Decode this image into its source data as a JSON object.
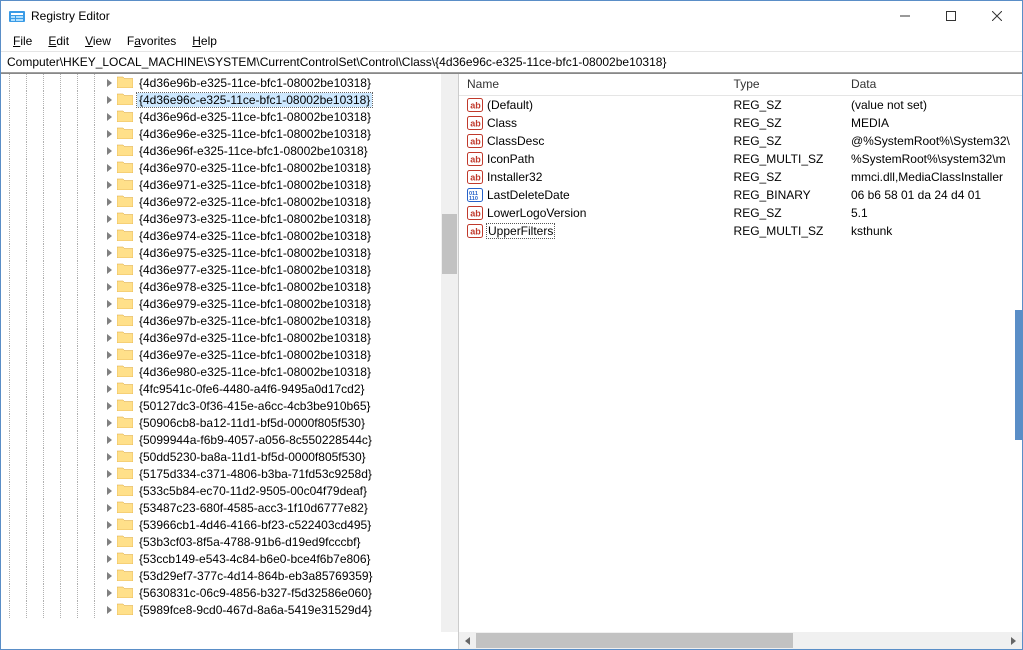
{
  "window": {
    "title": "Registry Editor"
  },
  "menu": {
    "file": "File",
    "edit": "Edit",
    "view": "View",
    "favorites": "Favorites",
    "help": "Help"
  },
  "address": "Computer\\HKEY_LOCAL_MACHINE\\SYSTEM\\CurrentControlSet\\Control\\Class\\{4d36e96c-e325-11ce-bfc1-08002be10318}",
  "columns": {
    "name": "Name",
    "type": "Type",
    "data": "Data"
  },
  "col_widths": {
    "name": 268,
    "type": 118,
    "data": 180
  },
  "tree_depth": 7,
  "selected_tree_index": 1,
  "tree": [
    "{4d36e96b-e325-11ce-bfc1-08002be10318}",
    "{4d36e96c-e325-11ce-bfc1-08002be10318}",
    "{4d36e96d-e325-11ce-bfc1-08002be10318}",
    "{4d36e96e-e325-11ce-bfc1-08002be10318}",
    "{4d36e96f-e325-11ce-bfc1-08002be10318}",
    "{4d36e970-e325-11ce-bfc1-08002be10318}",
    "{4d36e971-e325-11ce-bfc1-08002be10318}",
    "{4d36e972-e325-11ce-bfc1-08002be10318}",
    "{4d36e973-e325-11ce-bfc1-08002be10318}",
    "{4d36e974-e325-11ce-bfc1-08002be10318}",
    "{4d36e975-e325-11ce-bfc1-08002be10318}",
    "{4d36e977-e325-11ce-bfc1-08002be10318}",
    "{4d36e978-e325-11ce-bfc1-08002be10318}",
    "{4d36e979-e325-11ce-bfc1-08002be10318}",
    "{4d36e97b-e325-11ce-bfc1-08002be10318}",
    "{4d36e97d-e325-11ce-bfc1-08002be10318}",
    "{4d36e97e-e325-11ce-bfc1-08002be10318}",
    "{4d36e980-e325-11ce-bfc1-08002be10318}",
    "{4fc9541c-0fe6-4480-a4f6-9495a0d17cd2}",
    "{50127dc3-0f36-415e-a6cc-4cb3be910b65}",
    "{50906cb8-ba12-11d1-bf5d-0000f805f530}",
    "{5099944a-f6b9-4057-a056-8c550228544c}",
    "{50dd5230-ba8a-11d1-bf5d-0000f805f530}",
    "{5175d334-c371-4806-b3ba-71fd53c9258d}",
    "{533c5b84-ec70-11d2-9505-00c04f79deaf}",
    "{53487c23-680f-4585-acc3-1f10d6777e82}",
    "{53966cb1-4d46-4166-bf23-c522403cd495}",
    "{53b3cf03-8f5a-4788-91b6-d19ed9fcccbf}",
    "{53ccb149-e543-4c84-b6e0-bce4f6b7e806}",
    "{53d29ef7-377c-4d14-864b-eb3a85769359}",
    "{5630831c-06c9-4856-b327-f5d32586e060}",
    "{5989fce8-9cd0-467d-8a6a-5419e31529d4}"
  ],
  "selected_value_index": 7,
  "values": [
    {
      "name": "(Default)",
      "icon": "string",
      "type": "REG_SZ",
      "data": "(value not set)"
    },
    {
      "name": "Class",
      "icon": "string",
      "type": "REG_SZ",
      "data": "MEDIA"
    },
    {
      "name": "ClassDesc",
      "icon": "string",
      "type": "REG_SZ",
      "data": "@%SystemRoot%\\System32\\"
    },
    {
      "name": "IconPath",
      "icon": "string",
      "type": "REG_MULTI_SZ",
      "data": "%SystemRoot%\\system32\\m"
    },
    {
      "name": "Installer32",
      "icon": "string",
      "type": "REG_SZ",
      "data": "mmci.dll,MediaClassInstaller"
    },
    {
      "name": "LastDeleteDate",
      "icon": "binary",
      "type": "REG_BINARY",
      "data": "06 b6 58 01 da 24 d4 01"
    },
    {
      "name": "LowerLogoVersion",
      "icon": "string",
      "type": "REG_SZ",
      "data": "5.1"
    },
    {
      "name": "UpperFilters",
      "icon": "string",
      "type": "REG_MULTI_SZ",
      "data": "ksthunk"
    }
  ]
}
